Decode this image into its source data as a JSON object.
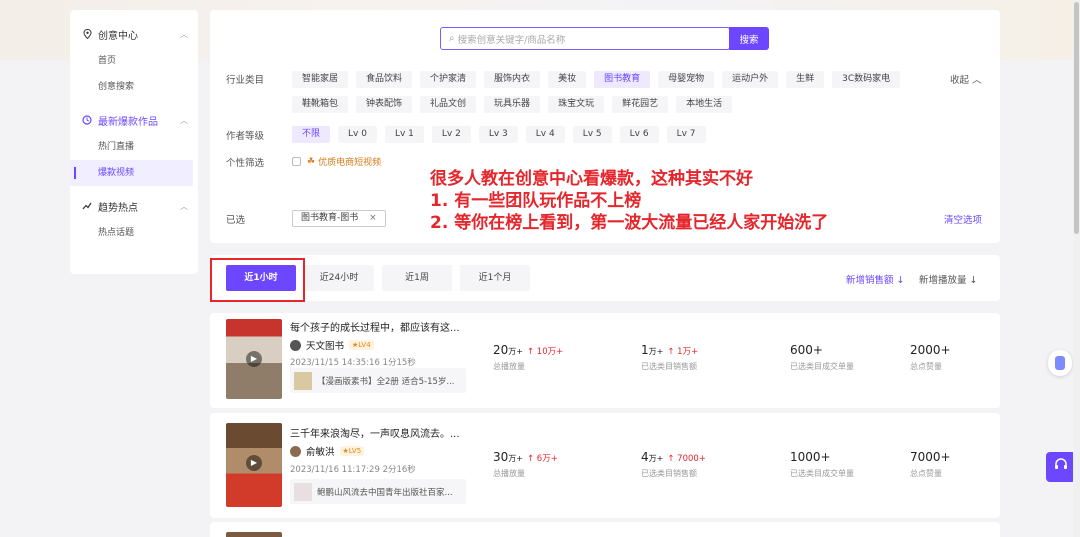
{
  "sidebar": {
    "groups": [
      {
        "label": "创意中心",
        "icon": "location-pin-icon",
        "items": [
          "首页",
          "创意搜索"
        ]
      },
      {
        "label": "最新爆款作品",
        "icon": "flame-icon",
        "items": [
          "热门直播",
          "爆款视频"
        ]
      },
      {
        "label": "趋势热点",
        "icon": "trend-icon",
        "items": [
          "热点话题"
        ]
      }
    ],
    "active_item": "爆款视频"
  },
  "search": {
    "placeholder": "搜索创意关键字/商品名称",
    "button": "搜索"
  },
  "filters": {
    "industry_label": "行业类目",
    "industry_tags": [
      "智能家居",
      "食品饮料",
      "个护家清",
      "服饰内衣",
      "美妆",
      "图书教育",
      "母婴宠物",
      "运动户外",
      "生鲜",
      "3C数码家电",
      "鞋靴箱包",
      "钟表配饰",
      "礼品文创",
      "玩具乐器",
      "珠宝文玩",
      "鲜花园艺",
      "本地生活"
    ],
    "industry_selected": "图书教育",
    "collapse": "收起",
    "level_label": "作者等级",
    "level_tags": [
      "不限",
      "Lv 0",
      "Lv 1",
      "Lv 2",
      "Lv 3",
      "Lv 4",
      "Lv 5",
      "Lv 6",
      "Lv 7"
    ],
    "level_selected": "不限",
    "personal_label": "个性筛选",
    "quality_option": "优质电商短视频",
    "selected_label": "已选",
    "selected_chip": "图书教育-图书",
    "clear": "清空选项"
  },
  "annotation": {
    "line1": "很多人教在创意中心看爆款，这种其实不好",
    "line2": "1. 有一些团队玩作品不上榜",
    "line3": "2. 等你在榜上看到，第一波大流量已经人家开始洗了"
  },
  "tabs": [
    "近1小时",
    "近24小时",
    "近1周",
    "近1个月"
  ],
  "active_tab": "近1小时",
  "sort": {
    "sales": "新增销售额 ↓",
    "plays": "新增播放量 ↓"
  },
  "accent": "#6c47ff",
  "annotation_color": "#e5262c",
  "cards": [
    {
      "title": "每个孩子的成长过程中，都应该有这...",
      "author": "天文图书",
      "level": "LV4",
      "time": "2023/11/15 14:35:16  1分15秒",
      "product": "【漫画版素书】全2册 适合5-15岁...",
      "metrics": [
        {
          "value": "20",
          "unit": "万+",
          "inc": "↑ 10万+",
          "label": "总播放量"
        },
        {
          "value": "1",
          "unit": "万+",
          "inc": "↑ 1万+",
          "label": "已选类目销售额"
        },
        {
          "value": "600+",
          "unit": "",
          "inc": "",
          "label": "已选类目成交单量"
        },
        {
          "value": "2000+",
          "unit": "",
          "inc": "",
          "label": "总点赞量"
        }
      ]
    },
    {
      "title": "三千年来浪淘尽，一声叹息风流去。...",
      "author": "俞敏洪",
      "level": "LV5",
      "time": "2023/11/16 11:17:29  2分16秒",
      "product": "鲍鹏山风流去中国青年出版社百家...",
      "metrics": [
        {
          "value": "30",
          "unit": "万+",
          "inc": "↑ 6万+",
          "label": "总播放量"
        },
        {
          "value": "4",
          "unit": "万+",
          "inc": "↑ 7000+",
          "label": "已选类目销售额"
        },
        {
          "value": "1000+",
          "unit": "",
          "inc": "",
          "label": "已选类目成交单量"
        },
        {
          "value": "7000+",
          "unit": "",
          "inc": "",
          "label": "总点赞量"
        }
      ]
    }
  ]
}
